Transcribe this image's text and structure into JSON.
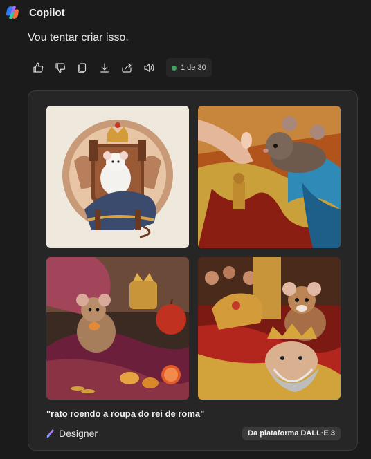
{
  "header": {
    "app_name": "Copilot",
    "logo_icon": "copilot-logo-icon"
  },
  "message": {
    "text": "Vou tentar criar isso."
  },
  "actions": {
    "icons": [
      "thumbs-up-icon",
      "thumbs-down-icon",
      "copy-icon",
      "download-icon",
      "share-icon",
      "speaker-icon"
    ],
    "turn_counter": "1 de 30",
    "status_color": "#3aa55d"
  },
  "image_card": {
    "caption": "\"rato roendo a roupa do rei de roma\"",
    "designer_label": "Designer",
    "designer_icon": "designer-brush-icon",
    "platform_badge": "Da plataforma DALL·E 3"
  }
}
